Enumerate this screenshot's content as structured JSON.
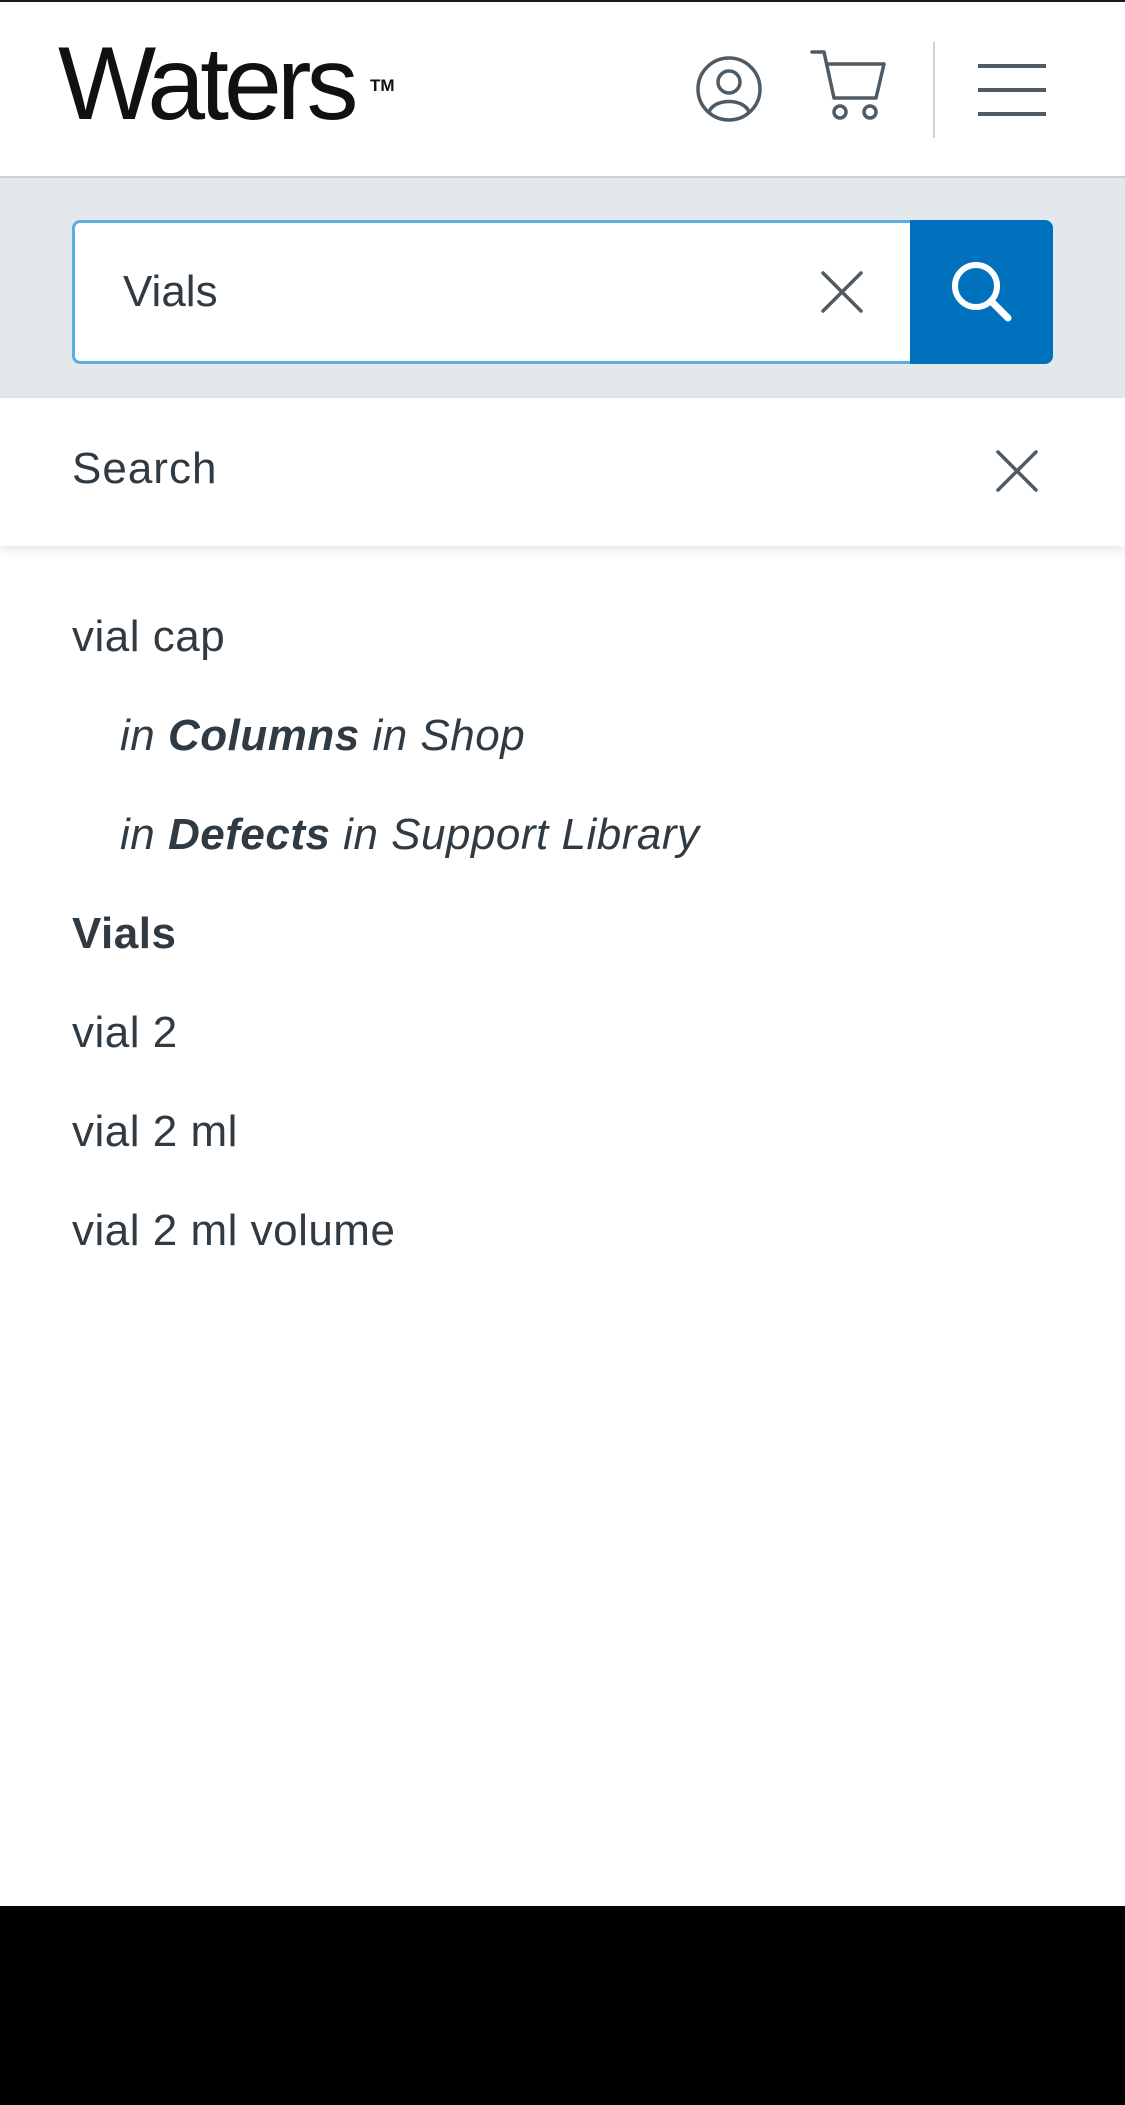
{
  "header": {
    "logo_text": "Waters",
    "logo_tm": "TM",
    "account_icon": "account-circle-icon",
    "cart_icon": "shopping-cart-icon",
    "menu_icon": "hamburger-menu-icon"
  },
  "search": {
    "value": "Vials",
    "clear_icon": "close-icon",
    "submit_icon": "search-icon"
  },
  "suggestions_panel": {
    "title": "Search",
    "close_icon": "close-icon",
    "items": [
      {
        "text": "vial cap"
      },
      {
        "prefix": "in ",
        "category": "Columns",
        "suffix": " in Shop"
      },
      {
        "prefix": "in ",
        "category": "Defects",
        "suffix": " in Support Library"
      },
      {
        "text": "Vials"
      },
      {
        "text": "vial 2"
      },
      {
        "text": "vial 2 ml"
      },
      {
        "text": "vial 2 ml volume"
      }
    ]
  },
  "colors": {
    "brand_blue": "#0071bc",
    "focus_border": "#5aaee0",
    "band_gray": "#e3e8ec",
    "text_dark": "#2f3a42"
  }
}
